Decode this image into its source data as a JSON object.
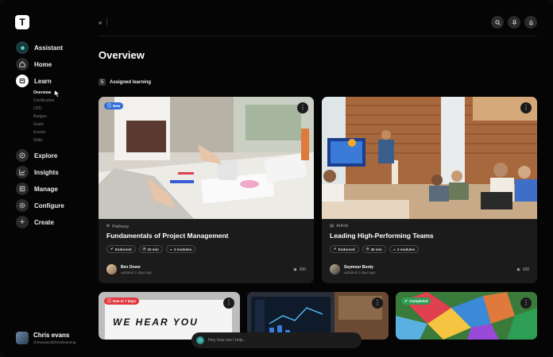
{
  "app": {
    "logo_letter": "T"
  },
  "sidebar": {
    "items": [
      {
        "label": "Assistant",
        "icon": "assistant-orb-icon"
      },
      {
        "label": "Home",
        "icon": "home-icon"
      },
      {
        "label": "Learn",
        "icon": "learn-icon",
        "active": true
      },
      {
        "label": "Explore",
        "icon": "compass-icon"
      },
      {
        "label": "Insights",
        "icon": "chart-icon"
      },
      {
        "label": "Manage",
        "icon": "manage-icon"
      },
      {
        "label": "Configure",
        "icon": "gear-icon"
      },
      {
        "label": "Create",
        "icon": "plus-icon"
      }
    ],
    "learn_subitems": [
      "Overview",
      "Certification",
      "CPD",
      "Badges",
      "Goals",
      "Events",
      "Skills"
    ],
    "active_subitem": "Overview"
  },
  "user": {
    "name": "Chris evans",
    "email": "chrisevans@thrivelearning"
  },
  "header": {
    "collapse_glyph": "«",
    "title": "Overview",
    "assigned_count": "5",
    "assigned_label": "Assigned learning"
  },
  "cards": [
    {
      "tag": "New",
      "type": "Pathway",
      "title": "Fundamentals of Project Management",
      "chips": [
        "Endorsed",
        "20 min",
        "3 modules"
      ],
      "author": "Ben Dover",
      "updated": "updated 2 days ago",
      "views": "100"
    },
    {
      "tag": "",
      "type": "Article",
      "title": "Leading High-Performing Teams",
      "chips": [
        "Endorsed",
        "45 min",
        "2 modules"
      ],
      "author": "Seymour Booty",
      "updated": "updated 2 days ago",
      "views": "100"
    },
    {
      "tag": "Due in 7 days",
      "poster_text": "WE HEAR YOU"
    },
    {
      "tag": ""
    },
    {
      "tag": "Completed"
    }
  ],
  "chat": {
    "placeholder": "Hey, how can I help..."
  },
  "colors": {
    "new": "#2f6fd6",
    "due": "#e0393e",
    "completed": "#2e9e55",
    "assistant": "#4fd1c5"
  }
}
